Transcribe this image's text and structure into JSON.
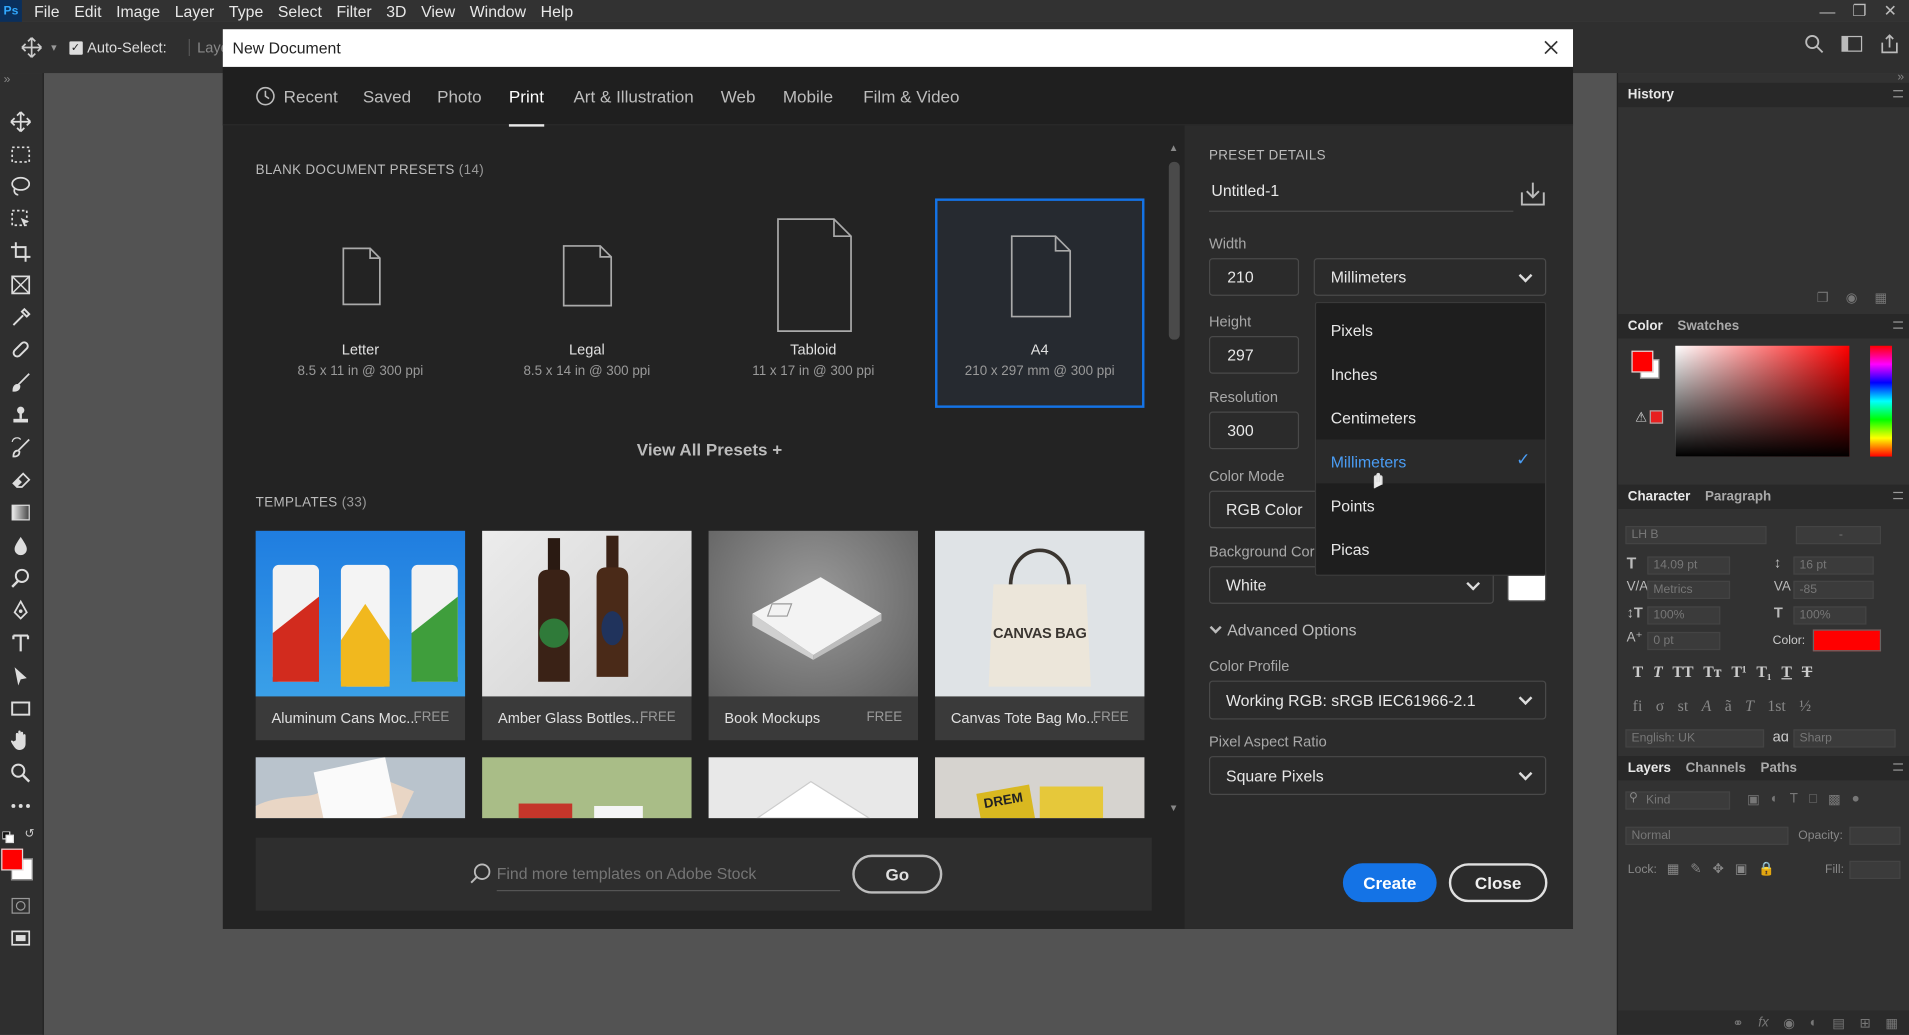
{
  "menubar": {
    "logo": "Ps",
    "items": [
      "File",
      "Edit",
      "Image",
      "Layer",
      "Type",
      "Select",
      "Filter",
      "3D",
      "View",
      "Window",
      "Help"
    ]
  },
  "options_bar": {
    "auto_select_label": "Auto-Select:",
    "layer_dropdown_value": "Laye"
  },
  "dialog": {
    "title": "New Document",
    "tabs": [
      "Recent",
      "Saved",
      "Photo",
      "Print",
      "Art & Illustration",
      "Web",
      "Mobile",
      "Film & Video"
    ],
    "active_tab": "Print",
    "blank_presets": {
      "heading": "BLANK DOCUMENT PRESETS",
      "count": "(14)",
      "items": [
        {
          "name": "Letter",
          "desc": "8.5 x 11 in @ 300 ppi"
        },
        {
          "name": "Legal",
          "desc": "8.5 x 14 in @ 300 ppi"
        },
        {
          "name": "Tabloid",
          "desc": "11 x 17 in @ 300 ppi"
        },
        {
          "name": "A4",
          "desc": "210 x 297 mm @ 300 ppi"
        }
      ],
      "selected": "A4"
    },
    "view_all": "View All Presets +",
    "templates": {
      "heading": "TEMPLATES",
      "count": "(33)",
      "items": [
        {
          "name": "Aluminum Cans Moc...",
          "price": "FREE"
        },
        {
          "name": "Amber Glass Bottles...",
          "price": "FREE"
        },
        {
          "name": "Book Mockups",
          "price": "FREE"
        },
        {
          "name": "Canvas Tote Bag Mo...",
          "price": "FREE"
        }
      ],
      "tote_text": "CANVAS BAG",
      "magazine_text": "DREM"
    },
    "stock_search": {
      "placeholder": "Find more templates on Adobe Stock",
      "go": "Go"
    },
    "details": {
      "heading": "PRESET DETAILS",
      "doc_name": "Untitled-1",
      "width_label": "Width",
      "width_value": "210",
      "width_unit": "Millimeters",
      "height_label": "Height",
      "height_value": "297",
      "resolution_label": "Resolution",
      "resolution_value": "300",
      "color_mode_label": "Color Mode",
      "color_mode_value": "RGB Color",
      "background_label": "Background Cor",
      "background_value": "White",
      "advanced": "Advanced Options",
      "color_profile_label": "Color Profile",
      "color_profile_value": "Working RGB: sRGB IEC61966-2.1",
      "pixel_aspect_label": "Pixel Aspect Ratio",
      "pixel_aspect_value": "Square Pixels",
      "create": "Create",
      "close": "Close"
    },
    "unit_menu": {
      "options": [
        "Pixels",
        "Inches",
        "Centimeters",
        "Millimeters",
        "Points",
        "Picas"
      ],
      "selected": "Millimeters"
    }
  },
  "panels": {
    "history": {
      "tab": "History"
    },
    "color": {
      "tabs": [
        "Color",
        "Swatches"
      ]
    },
    "character": {
      "tabs": [
        "Character",
        "Paragraph"
      ],
      "font": "LH B",
      "style": "-",
      "size": "14.09 pt",
      "leading": "16 pt",
      "kerning": "Metrics",
      "tracking": "-85",
      "vscale": "100%",
      "hscale": "100%",
      "baseline": "0 pt",
      "color_label": "Color:",
      "language": "English: UK",
      "aa_label": "aɑ",
      "antialias": "Sharp"
    },
    "layers": {
      "tabs": [
        "Layers",
        "Channels",
        "Paths"
      ],
      "kind": "Kind",
      "blend": "Normal",
      "opacity_label": "Opacity:",
      "lock_label": "Lock:",
      "fill_label": "Fill:"
    }
  },
  "colors": {
    "accent": "#1473e6",
    "foreground": "#ff0000",
    "background": "#ffffff"
  }
}
